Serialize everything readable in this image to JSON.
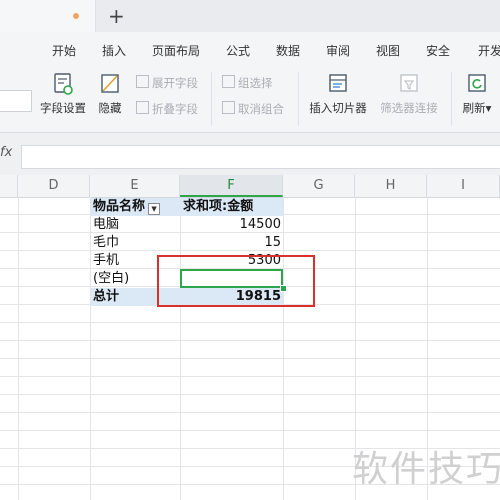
{
  "tabbar": {
    "new_tab_label": "+"
  },
  "menu": {
    "items": [
      "开始",
      "插入",
      "页面布局",
      "公式",
      "数据",
      "审阅",
      "视图",
      "安全",
      "开发"
    ],
    "cut_glyph": "ı"
  },
  "ribbon": {
    "field_settings": "字段设置",
    "hide": "隐藏",
    "expand_field": "展开字段",
    "collapse_field": "折叠字段",
    "group_selection": "组选择",
    "ungroup": "取消组合",
    "insert_slicer": "插入切片器",
    "filter_connection": "筛选器连接",
    "refresh": "刷新",
    "refresh_arrow": "▾"
  },
  "formula_bar": {
    "fx_label": "fx",
    "value": ""
  },
  "columns": [
    "D",
    "E",
    "F",
    "G",
    "H",
    "I"
  ],
  "pivot": {
    "header_field": "物品名称",
    "header_value": "求和项:金额",
    "filter_glyph": "▼",
    "rows": [
      {
        "name": "电脑",
        "value": "14500"
      },
      {
        "name": "毛巾",
        "value": "15"
      },
      {
        "name": "手机",
        "value": "5300"
      },
      {
        "name": "(空白)",
        "value": ""
      }
    ],
    "total_label": "总计",
    "total_value": "19815"
  },
  "watermark": "软件技巧"
}
